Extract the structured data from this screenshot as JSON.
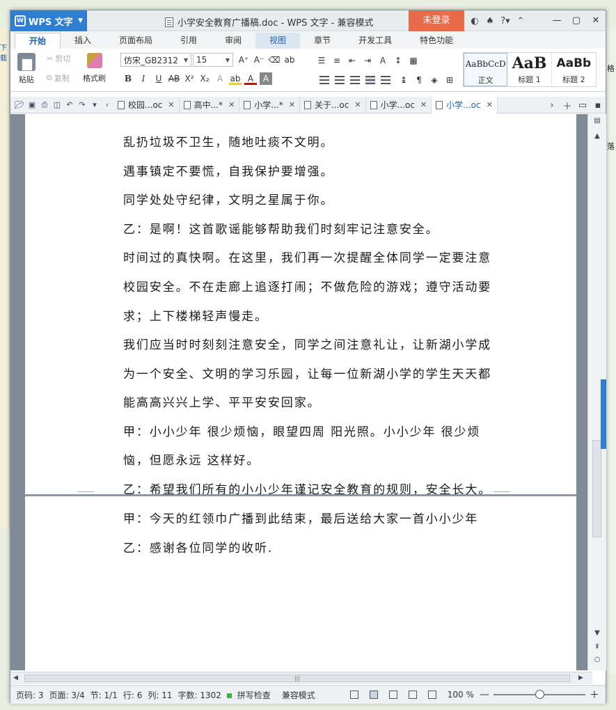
{
  "app": {
    "name": "WPS 文字",
    "doc_title": "小学安全教育广播稿.doc - WPS 文字 - 兼容模式",
    "login": "未登录"
  },
  "ribbon_tabs": [
    "开始",
    "插入",
    "页面布局",
    "引用",
    "审阅",
    "视图",
    "章节",
    "开发工具",
    "特色功能"
  ],
  "ribbon": {
    "paste": "粘贴",
    "cut": "剪切",
    "copy": "复制",
    "format_painter": "格式刷",
    "font_name": "仿宋_GB2312",
    "font_size": "15",
    "styles": [
      {
        "preview": "AaBbCcD",
        "name": "正文"
      },
      {
        "preview": "AaB",
        "name": "标题 1"
      },
      {
        "preview": "AaBb",
        "name": "标题 2"
      }
    ]
  },
  "doc_tabs": [
    "校园...oc",
    "高中...*",
    "小学...*",
    "关于...oc",
    "小学...oc",
    "小学...oc"
  ],
  "document": {
    "page1_lines": [
      "乱扔垃圾不卫生，随地吐痰不文明。",
      "遇事镇定不要慌，自我保护要增强。",
      "同学处处守纪律，文明之星属于你。",
      "乙：是啊！这首歌谣能够帮助我们时刻牢记注意安全。",
      "时间过的真快啊。在这里，我们再一次提醒全体同学一定要注意",
      "校园安全。不在走廊上追逐打闹；不做危险的游戏；遵守活动要",
      "求；上下楼梯轻声慢走。",
      "我们应当时时刻刻注意安全，同学之间注意礼让，让新湖小学成",
      "为一个安全、文明的学习乐园，让每一位新湖小学的学生天天都",
      "能高高兴兴上学、平平安安回家。",
      "甲：小小少年 很少烦恼，眼望四周 阳光照。小小少年 很少烦",
      "恼，但愿永远 这样好。",
      "乙：希望我们所有的小小少年谨记安全教育的规则，安全长大。"
    ],
    "page2_lines": [
      "甲：今天的红领巾广播到此结束，最后送给大家一首小小少年",
      "乙：感谢各位同学的收听."
    ]
  },
  "status": {
    "page_no": "页码: 3",
    "pages": "页面: 3/4",
    "section": "节: 1/1",
    "row": "行: 6",
    "col": "列: 11",
    "words": "字数: 1302",
    "spell": "拼写检查",
    "compat": "兼容模式",
    "zoom": "100 %"
  },
  "background_fragments": {
    "left": "下载",
    "right_1": "落",
    "right_2": "格"
  },
  "colors": {
    "accent": "#2f7ed1",
    "login": "#e96b4a"
  }
}
